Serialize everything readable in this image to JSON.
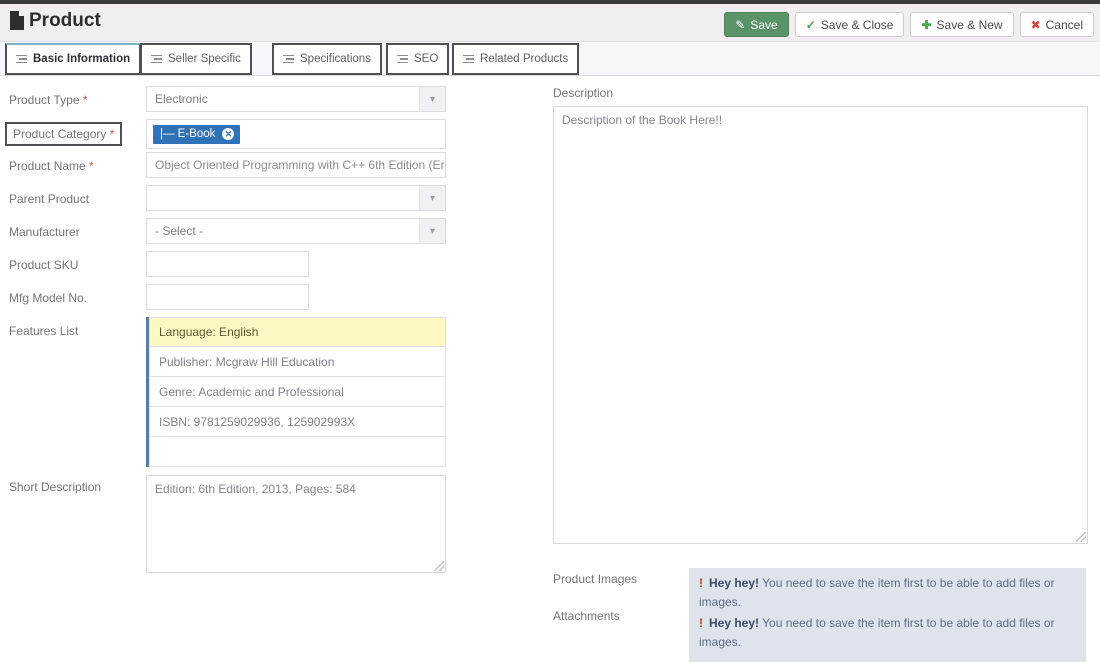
{
  "header": {
    "title": "Product",
    "icon": "document-icon",
    "buttons": [
      {
        "label": "Save",
        "icon": "edit-icon",
        "style": "primary"
      },
      {
        "label": "Save & Close",
        "icon": "check-icon",
        "style": "default"
      },
      {
        "label": "Save & New",
        "icon": "plus-icon",
        "style": "default"
      },
      {
        "label": "Cancel",
        "icon": "cancel-icon",
        "style": "default"
      }
    ]
  },
  "tabs": [
    {
      "label": "Basic Information",
      "active": true
    },
    {
      "label": "Seller Specific",
      "active": false
    },
    {
      "label": "Specifications",
      "active": false
    },
    {
      "label": "SEO",
      "active": false
    },
    {
      "label": "Related Products",
      "active": false
    }
  ],
  "form": {
    "product_type": {
      "label": "Product Type",
      "required": "*",
      "value": "Electronic"
    },
    "product_category": {
      "label": "Product Category",
      "required": "*",
      "token": "|— E-Book"
    },
    "product_name": {
      "label": "Product Name",
      "required": "*",
      "value": "Object Oriented Programming with C++ 6th Edition  (Er"
    },
    "parent_product": {
      "label": "Parent Product",
      "value": ""
    },
    "manufacturer": {
      "label": "Manufacturer",
      "value": "- Select -"
    },
    "product_sku": {
      "label": "Product SKU",
      "value": ""
    },
    "mfg_model_no": {
      "label": "Mfg Model No.",
      "value": ""
    },
    "features_list": {
      "label": "Features List",
      "items": [
        "Language: English",
        "Publisher: Mcgraw Hill Education",
        "Genre: Academic and Professional",
        "ISBN: 9781259029936, 125902993X",
        ""
      ]
    },
    "short_description": {
      "label": "Short Description",
      "value": "Edition: 6th Edition, 2013,  Pages: 584"
    }
  },
  "right": {
    "description": {
      "label": "Description",
      "value": "Description of the Book Here!!"
    },
    "product_images": {
      "label": "Product Images"
    },
    "attachments": {
      "label": "Attachments"
    },
    "alerts": [
      {
        "strong": "Hey hey!",
        "text": " You need to save the item first to be able to add files or images."
      },
      {
        "strong": "Hey hey!",
        "text": " You need to save the item first to be able to add files or images."
      }
    ]
  },
  "colors": {
    "save_green": "#5a9367",
    "token_blue": "#2f72b8",
    "highlight_yellow": "#fbf8c4",
    "alert_bg": "#dfe3eb",
    "alert_bang": "#c0392b"
  }
}
